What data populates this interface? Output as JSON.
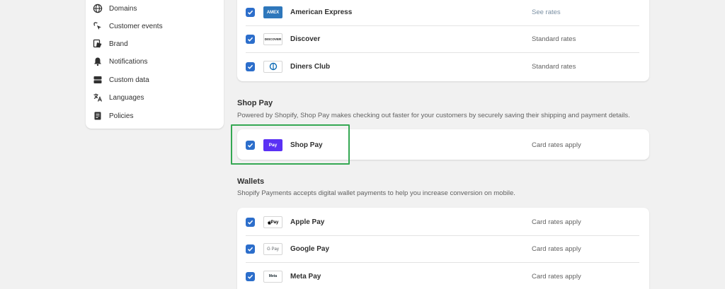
{
  "sidebar": {
    "items": [
      {
        "label": "Domains",
        "icon": "globe-icon"
      },
      {
        "label": "Customer events",
        "icon": "cursor-sparkle-icon"
      },
      {
        "label": "Brand",
        "icon": "brand-tag-icon"
      },
      {
        "label": "Notifications",
        "icon": "bell-icon"
      },
      {
        "label": "Custom data",
        "icon": "database-icon"
      },
      {
        "label": "Languages",
        "icon": "translate-icon"
      },
      {
        "label": "Policies",
        "icon": "document-icon"
      }
    ]
  },
  "cards_top": {
    "rows": [
      {
        "name": "American Express",
        "rate": "See rates",
        "logo": "AMEX",
        "checked": true
      },
      {
        "name": "Discover",
        "rate": "Standard rates",
        "logo": "DISCOVER",
        "checked": true
      },
      {
        "name": "Diners Club",
        "rate": "Standard rates",
        "logo": "Diners",
        "checked": true
      }
    ]
  },
  "shop_pay": {
    "title": "Shop Pay",
    "description": "Powered by Shopify, Shop Pay makes checking out faster for your customers by securely saving their shipping and payment details.",
    "row": {
      "name": "Shop Pay",
      "rate": "Card rates apply",
      "logo": "Pay",
      "checked": true
    }
  },
  "wallets": {
    "title": "Wallets",
    "description": "Shopify Payments accepts digital wallet payments to help you increase conversion on mobile.",
    "rows": [
      {
        "name": "Apple Pay",
        "rate": "Card rates apply",
        "logo": "Pay",
        "checked": true
      },
      {
        "name": "Google Pay",
        "rate": "Card rates apply",
        "logo": "G Pay",
        "checked": true
      },
      {
        "name": "Meta Pay",
        "rate": "Card rates apply",
        "logo": "Meta",
        "checked": true
      }
    ]
  },
  "colors": {
    "checkbox": "#2c6ecb",
    "highlight": "#35a853",
    "shop_pay": "#5a31f4",
    "amex": "#2e77bb"
  }
}
